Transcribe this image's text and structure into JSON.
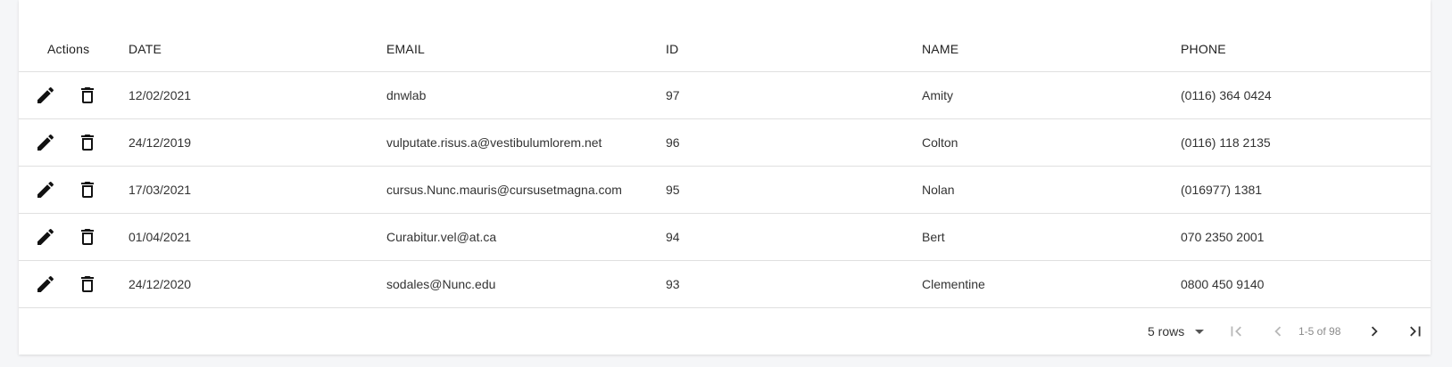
{
  "table": {
    "headers": {
      "actions": "Actions",
      "date": "DATE",
      "email": "EMAIL",
      "id": "ID",
      "name": "NAME",
      "phone": "PHONE"
    },
    "rows": [
      {
        "date": "12/02/2021",
        "email": "dnwlab",
        "id": "97",
        "name": "Amity",
        "phone": "(0116) 364 0424"
      },
      {
        "date": "24/12/2019",
        "email": "vulputate.risus.a@vestibulumlorem.net",
        "id": "96",
        "name": "Colton",
        "phone": "(0116) 118 2135"
      },
      {
        "date": "17/03/2021",
        "email": "cursus.Nunc.mauris@cursusetmagna.com",
        "id": "95",
        "name": "Nolan",
        "phone": "(016977) 1381"
      },
      {
        "date": "01/04/2021",
        "email": "Curabitur.vel@at.ca",
        "id": "94",
        "name": "Bert",
        "phone": "070 2350 2001"
      },
      {
        "date": "24/12/2020",
        "email": "sodales@Nunc.edu",
        "id": "93",
        "name": "Clementine",
        "phone": "0800 450 9140"
      }
    ],
    "row_icons": {
      "edit": "pencil-icon",
      "delete": "trash-icon"
    }
  },
  "pagination": {
    "rows_per_page_label": "5 rows",
    "range_label": "1-5 of 98",
    "icons": {
      "first": "first-page-icon",
      "prev": "chevron-left-icon",
      "next": "chevron-right-icon",
      "last": "last-page-icon"
    },
    "colors": {
      "disabled": "#b8b8b8",
      "enabled": "#333333"
    }
  }
}
